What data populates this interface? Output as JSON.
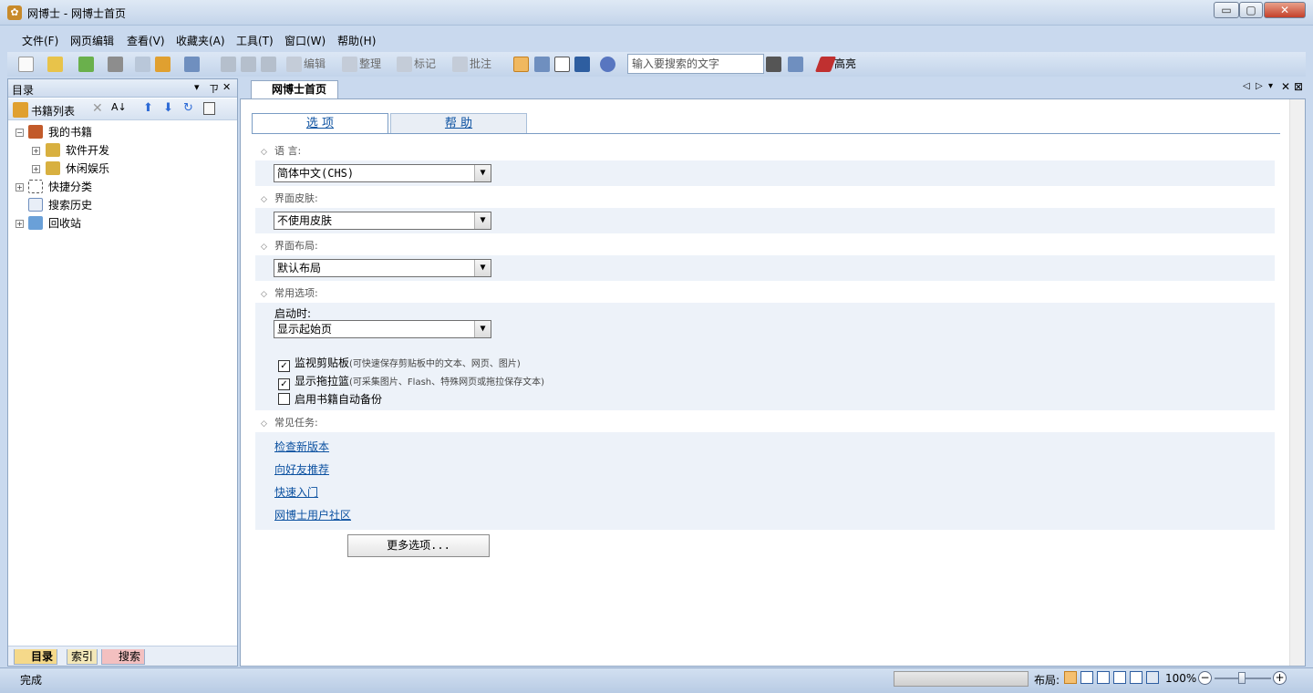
{
  "window": {
    "title": "网博士 - 网博士首页",
    "controls": {
      "minimize": "▭",
      "maximize": "▢",
      "close": "✕"
    }
  },
  "menu": [
    "文件(F)",
    "网页编辑",
    "查看(V)",
    "收藏夹(A)",
    "工具(T)",
    "窗口(W)",
    "帮助(H)"
  ],
  "toolbar": {
    "edit": "编辑",
    "organize": "整理",
    "mark": "标记",
    "annotate": "批注",
    "search_placeholder": "输入要搜索的文字",
    "highlight": "高亮"
  },
  "left_panel": {
    "title": "目录",
    "header_icons": [
      "▾",
      "ㄗ",
      "✕"
    ],
    "tools": {
      "book_list": "书籍列表"
    },
    "tree": [
      {
        "label": "我的书籍",
        "level": 0,
        "expander": "−"
      },
      {
        "label": "软件开发",
        "level": 1,
        "expander": "+"
      },
      {
        "label": "休闲娱乐",
        "level": 1,
        "expander": "+"
      },
      {
        "label": "快捷分类",
        "level": 0,
        "expander": "+"
      },
      {
        "label": "搜索历史",
        "level": 0,
        "expander": ""
      },
      {
        "label": "回收站",
        "level": 0,
        "expander": "+"
      }
    ],
    "bottom_tabs": [
      "目录",
      "索引",
      "搜索"
    ]
  },
  "document": {
    "tab_title": "网博士首页",
    "page_tabs": [
      "选 项",
      "帮 助"
    ],
    "sections": {
      "language": {
        "label": "语 言:",
        "value": "简体中文(CHS)"
      },
      "skin": {
        "label": "界面皮肤:",
        "value": "不使用皮肤"
      },
      "layout": {
        "label": "界面布局:",
        "value": "默认布局"
      },
      "common": {
        "label": "常用选项:",
        "startup_label": "启动时:",
        "startup_value": "显示起始页",
        "checkboxes": [
          {
            "label": "监视剪贴板",
            "hint": "(可快速保存剪贴板中的文本、网页、图片)",
            "checked": true
          },
          {
            "label": "显示拖拉篮",
            "hint": "(可采集图片、Flash、特殊网页或拖拉保存文本)",
            "checked": true
          },
          {
            "label": "启用书籍自动备份",
            "hint": "",
            "checked": false
          }
        ]
      },
      "tasks": {
        "label": "常见任务:",
        "links": [
          "检查新版本",
          "向好友推荐",
          "快速入门",
          "网博士用户社区"
        ]
      }
    },
    "more_button": "更多选项..."
  },
  "statusbar": {
    "status": "完成",
    "layout_label": "布局:",
    "zoom": "100%",
    "zoom_level": 0.5
  },
  "colors": {
    "accent": "#0d52a1",
    "chrome": "#c9d9ee",
    "section_bg": "#edf2f9"
  }
}
